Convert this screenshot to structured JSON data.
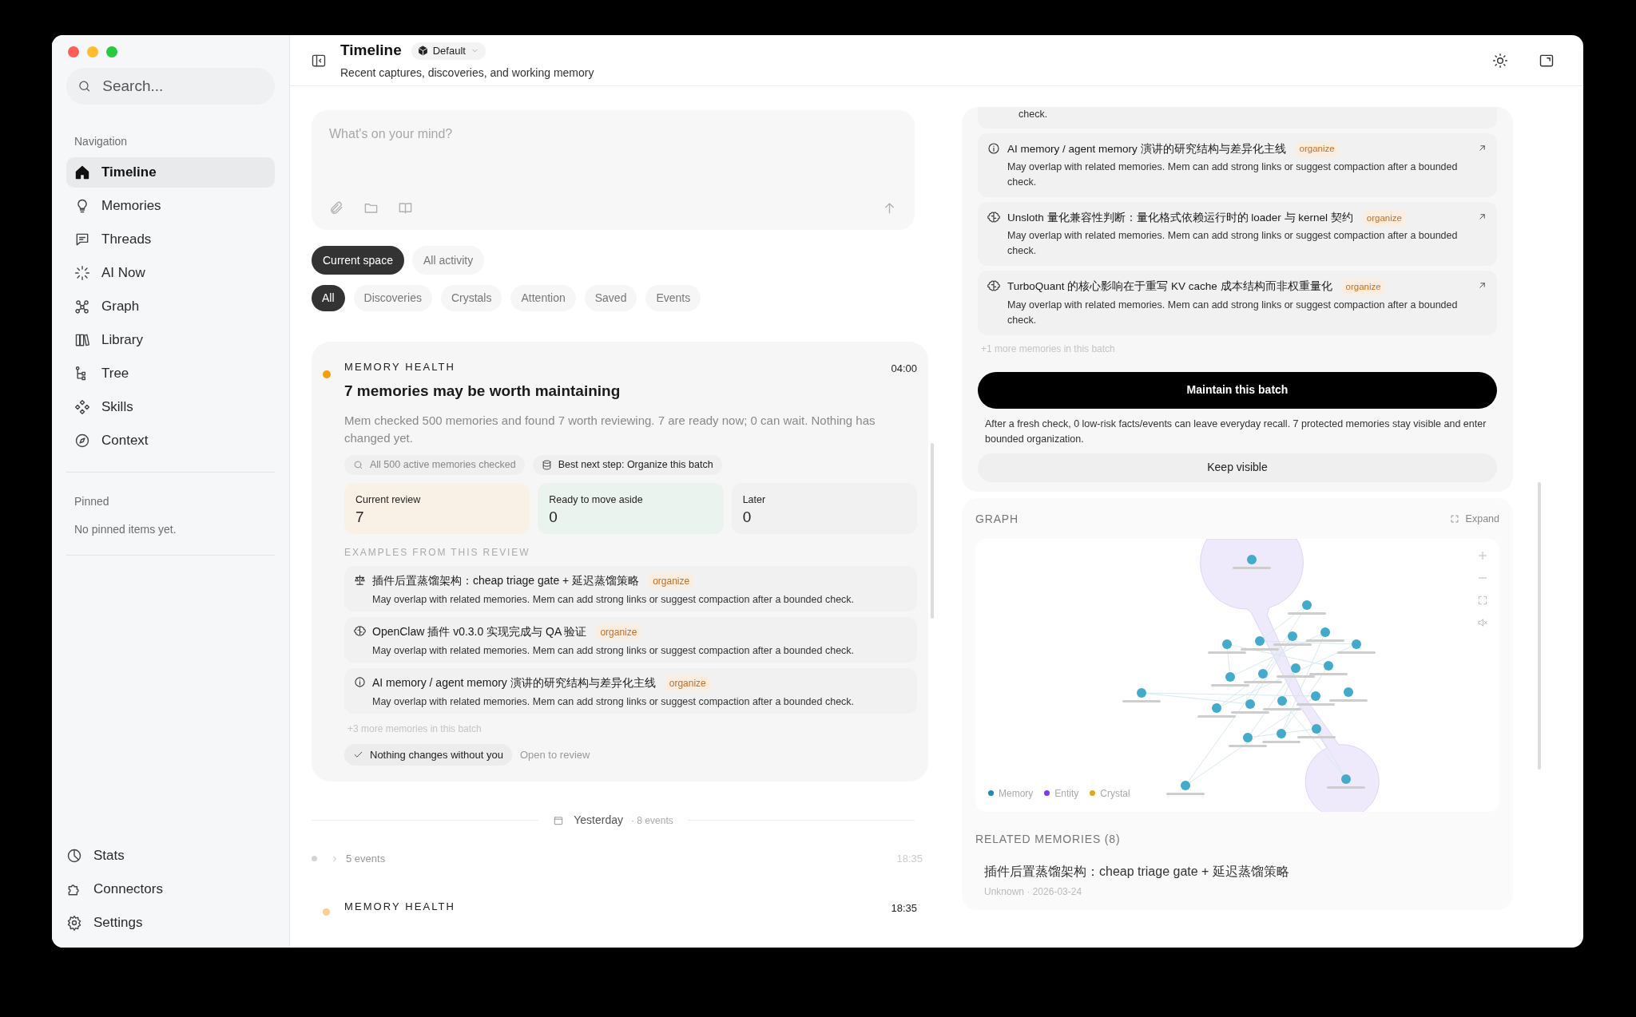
{
  "sidebar": {
    "search": {
      "placeholder": "Search..."
    },
    "nav_heading": "Navigation",
    "nav_items": [
      {
        "label": "Timeline",
        "selected": true
      },
      {
        "label": "Memories",
        "selected": false
      },
      {
        "label": "Threads",
        "selected": false
      },
      {
        "label": "AI Now",
        "selected": false
      },
      {
        "label": "Graph",
        "selected": false
      },
      {
        "label": "Library",
        "selected": false
      },
      {
        "label": "Tree",
        "selected": false
      },
      {
        "label": "Skills",
        "selected": false
      },
      {
        "label": "Context",
        "selected": false
      }
    ],
    "pinned": {
      "heading": "Pinned",
      "empty_text": "No pinned items yet."
    },
    "bottom_items": [
      {
        "label": "Stats"
      },
      {
        "label": "Connectors"
      },
      {
        "label": "Settings"
      }
    ]
  },
  "header": {
    "title": "Timeline",
    "space": "Default",
    "subtitle": "Recent captures, discoveries, and working memory"
  },
  "composer": {
    "placeholder": "What's on your mind?"
  },
  "scope_tabs": [
    {
      "label": "Current space",
      "selected": true
    },
    {
      "label": "All activity",
      "selected": false
    }
  ],
  "filters": [
    {
      "label": "All",
      "selected": true
    },
    {
      "label": "Discoveries",
      "selected": false
    },
    {
      "label": "Crystals",
      "selected": false
    },
    {
      "label": "Attention",
      "selected": false
    },
    {
      "label": "Saved",
      "selected": false
    },
    {
      "label": "Events",
      "selected": false
    }
  ],
  "timeline": [
    {
      "kind": "health",
      "color": "#f59e0b",
      "category": "MEMORY HEALTH",
      "time": "04:00",
      "title": "7 memories may be worth maintaining",
      "body": "Mem checked 500 memories and found 7 worth reviewing. 7 are ready now; 0 can wait. Nothing has changed yet.",
      "chips": [
        {
          "label": "All 500 active memories checked",
          "emphasis": false
        },
        {
          "label": "Best next step: Organize this batch",
          "emphasis": true
        }
      ],
      "stats": [
        {
          "label": "Current review",
          "value": "7",
          "color": "#faf1e6"
        },
        {
          "label": "Ready to move aside",
          "value": "0",
          "color": "#ebf3ef"
        },
        {
          "label": "Later",
          "value": "0",
          "color": "#f1f1f1"
        }
      ],
      "examples_heading": "EXAMPLES FROM THIS REVIEW",
      "examples": [
        {
          "title": "插件后置蒸馏架构：cheap triage gate + 延迟蒸馏策略",
          "tag": "organize",
          "text": "May overlap with related memories. Mem can add strong links or suggest compaction after a bounded check."
        },
        {
          "title": "OpenClaw 插件 v0.3.0 实现完成与 QA 验证",
          "tag": "organize",
          "text": "May overlap with related memories. Mem can add strong links or suggest compaction after a bounded check."
        },
        {
          "title": "AI memory / agent memory 演讲的研究结构与差异化主线",
          "tag": "organize",
          "text": "May overlap with related memories. Mem can add strong links or suggest compaction after a bounded check."
        }
      ],
      "more": "+3 more memories in this batch",
      "safe_note": "Nothing changes without you",
      "open_link": "Open to review"
    },
    {
      "kind": "divider",
      "label": "Yesterday",
      "count": "· 8 events"
    },
    {
      "kind": "group",
      "label": "5 events",
      "time": "18:35",
      "expanded": false
    },
    {
      "kind": "health",
      "color": "#f8d08f",
      "category": "MEMORY HEALTH",
      "time": "18:35"
    }
  ],
  "review_panel": {
    "cut_item_text": "check.",
    "items": [
      {
        "title": "AI memory / agent memory 演讲的研究结构与差异化主线",
        "tag": "organize",
        "text": "May overlap with related memories. Mem can add strong links or suggest compaction after a bounded check."
      },
      {
        "title": "Unsloth 量化兼容性判断：量化格式依赖运行时的 loader 与 kernel 契约",
        "tag": "organize",
        "text": "May overlap with related memories. Mem can add strong links or suggest compaction after a bounded check."
      },
      {
        "title": "TurboQuant 的核心影响在于重写 KV cache 成本结构而非权重量化",
        "tag": "organize",
        "text": "May overlap with related memories. Mem can add strong links or suggest compaction after a bounded check."
      }
    ],
    "more": "+1 more memories in this batch",
    "primary_button": "Maintain this batch",
    "note": "After a fresh check, 0 low-risk facts/events can leave everyday recall. 7 protected memories stay visible and enter bounded organization.",
    "secondary_button": "Keep visible"
  },
  "graph": {
    "heading": "GRAPH",
    "expand": "Expand",
    "legend": [
      {
        "label": "Memory",
        "color": "#1e88b8"
      },
      {
        "label": "Entity",
        "color": "#7c3aed"
      },
      {
        "label": "Crystal",
        "color": "#e0a526"
      }
    ]
  },
  "related": {
    "heading": "RELATED MEMORIES (8)",
    "items": [
      {
        "title": "插件后置蒸馏架构：cheap triage gate + 延迟蒸馏策略",
        "meta": "Unknown · 2026-03-24"
      }
    ]
  }
}
